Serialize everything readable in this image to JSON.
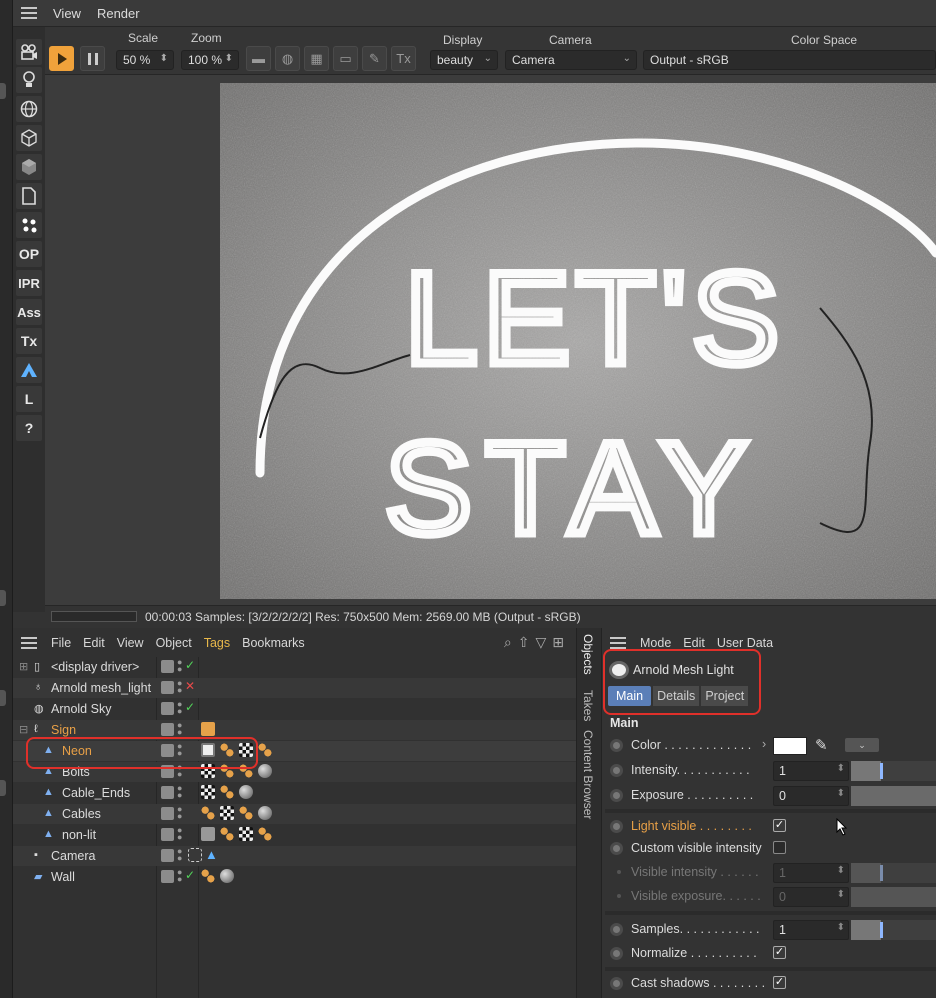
{
  "renderview": {
    "menu": [
      "View",
      "Render"
    ],
    "toolbar": {
      "scale_label": "Scale",
      "scale_value": "50 %",
      "zoom_label": "Zoom",
      "zoom_value": "100 %",
      "display_label": "Display",
      "display_value": "beauty",
      "camera_label": "Camera",
      "camera_value": "Camera",
      "colorspace_label": "Color Space",
      "colorspace_value": "Output - sRGB",
      "tx_label": "Tx"
    },
    "left_tools": [
      "OP",
      "IPR",
      "Ass",
      "Tx",
      "L",
      "?"
    ],
    "render_image": {
      "line1": "LET'S",
      "line2": "STAY"
    },
    "status": "00:00:03  Samples: [3/2/2/2/2/2]  Res: 750x500  Mem: 2569.00 MB  (Output - sRGB)"
  },
  "object_manager": {
    "menu": [
      "File",
      "Edit",
      "View",
      "Object",
      "Tags",
      "Bookmarks"
    ],
    "rows": [
      {
        "name": "<display driver>"
      },
      {
        "name": "Arnold mesh_light"
      },
      {
        "name": "Arnold Sky"
      },
      {
        "name": "Sign"
      },
      {
        "name": "Neon"
      },
      {
        "name": "Bolts"
      },
      {
        "name": "Cable_Ends"
      },
      {
        "name": "Cables"
      },
      {
        "name": "non-lit"
      },
      {
        "name": "Camera"
      },
      {
        "name": "Wall"
      }
    ]
  },
  "side_tabs": [
    "Objects",
    "Takes",
    "Content Browser"
  ],
  "attributes": {
    "menu": [
      "Mode",
      "Edit",
      "User Data"
    ],
    "object_title": "Arnold Mesh Light",
    "tabs": [
      "Main",
      "Details",
      "Project"
    ],
    "active_tab": "Main",
    "section": "Main",
    "params": {
      "color": "Color . . . . . . . . . . . . .",
      "intensity": "Intensity. . . . . . . . . . .",
      "intensity_value": "1",
      "exposure": "Exposure . . . . . . . . . .",
      "exposure_value": "0",
      "light_visible": "Light visible . . . . . . . .",
      "custom_visible_intensity": "Custom visible intensity",
      "visible_intensity": "Visible intensity . . . . . .",
      "visible_intensity_value": "1",
      "visible_exposure": "Visible exposure. . . . . .",
      "visible_exposure_value": "0",
      "samples": "Samples. . . . . . . . . . . .",
      "samples_value": "1",
      "normalize": "Normalize . . . . . . . . . .",
      "cast_shadows": "Cast shadows . . . . . . . ."
    },
    "color_swatch": "#ffffff",
    "accent": "#e8a047",
    "highlight": "#e0302a"
  }
}
